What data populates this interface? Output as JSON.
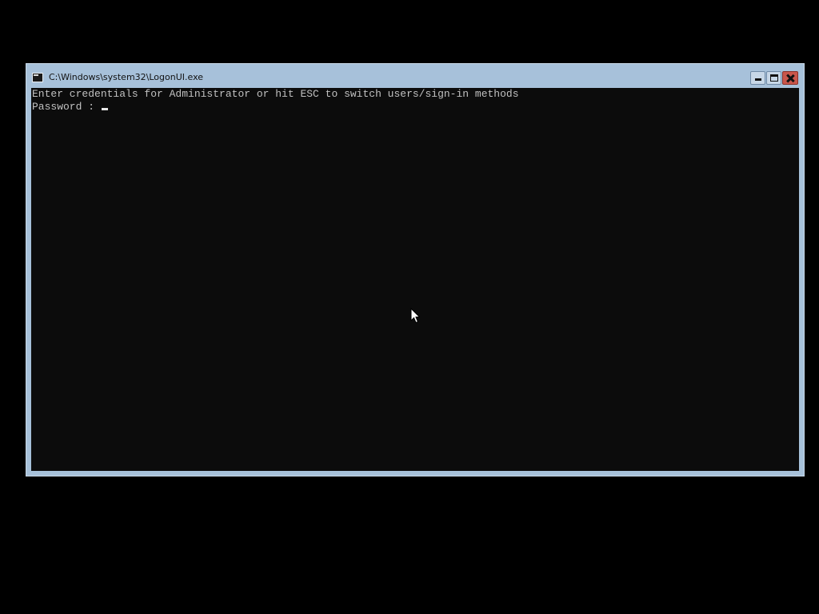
{
  "window": {
    "title": "C:\\Windows\\system32\\LogonUI.exe",
    "icon": "console-window-icon",
    "controls": {
      "minimize": "minimize-icon",
      "maximize": "maximize-icon",
      "close": "close-icon"
    }
  },
  "console": {
    "prompt_message": "Enter credentials for Administrator or hit ESC to switch users/sign-in methods",
    "password_prompt": "Password : ",
    "password_value": ""
  },
  "colors": {
    "desktop_background": "#000000",
    "window_frame": "#a7c1da",
    "console_background": "#0c0c0c",
    "console_text": "#c0c0c0",
    "close_button": "#c9564b"
  }
}
